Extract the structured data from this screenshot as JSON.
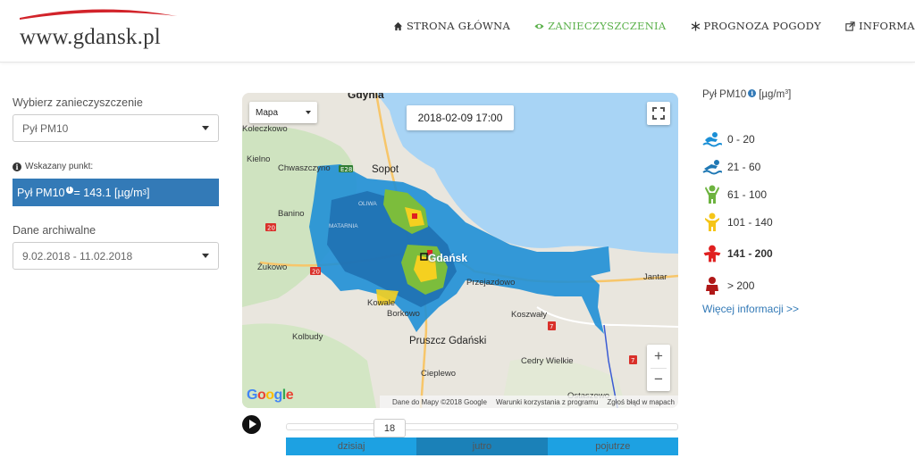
{
  "header": {
    "logo_text": "www.gdansk.pl",
    "nav": [
      {
        "label": "STRONA GŁÓWNA",
        "icon": "home-icon",
        "active": false
      },
      {
        "label": "ZANIECZYSZCZENIA",
        "icon": "eye-icon",
        "active": true
      },
      {
        "label": "PROGNOZA POGODY",
        "icon": "snowflake-icon",
        "active": false
      },
      {
        "label": "INFORMACJE",
        "icon": "external-link-icon",
        "active": false,
        "dropdown": true
      }
    ]
  },
  "sidebar": {
    "pollutant_label": "Wybierz zanieczyszczenie",
    "pollutant_value": "Pył PM10",
    "point_label": "Wskazany punkt:",
    "point_value_prefix": "Pył PM10",
    "point_value_text": " = 143.1 [µg/m",
    "point_value_unit_sup": "3",
    "point_value_suffix": "]",
    "archive_label": "Dane archiwalne",
    "archive_value": "9.02.2018 - 11.02.2018"
  },
  "map": {
    "type_control": "Mapa",
    "datetime": "2018-02-09 17:00",
    "zoom_in": "+",
    "zoom_out": "−",
    "google_logo": "Google",
    "attribution": [
      "Dane do Mapy ©2018 Google",
      "Warunki korzystania z programu",
      "Zgłoś błąd w mapach"
    ],
    "places": [
      "Gdynia",
      "Sopot",
      "Gdańsk",
      "Pruszcz Gdański",
      "Kowale",
      "Borkowo",
      "Chwaszczyno",
      "Banino",
      "Żukowo",
      "Kielno",
      "Koleczkowo",
      "Jantar",
      "Koszwały",
      "Przejazdowo",
      "Cedry Wielkie",
      "Cieplewo",
      "Kolbudy",
      "Ostaszewo",
      "OLIWA",
      "MATARNIA"
    ],
    "roads": [
      "E28",
      "20",
      "20",
      "7",
      "7"
    ]
  },
  "timeline": {
    "hour": "18",
    "days": [
      {
        "label": "dzisiaj",
        "active": false
      },
      {
        "label": "jutro",
        "active": true
      },
      {
        "label": "pojutrze",
        "active": false
      }
    ]
  },
  "legend": {
    "title": "Pył PM10",
    "unit_text": " [µg/m",
    "unit_sup": "3",
    "unit_suffix": "]",
    "items": [
      {
        "range": "0 - 20",
        "color": "#1b8fd6",
        "icon": "swimmer-icon"
      },
      {
        "range": "21 - 60",
        "color": "#1f78b4",
        "icon": "swimmer-icon"
      },
      {
        "range": "61 - 100",
        "color": "#6db33f",
        "icon": "person-arms-up-icon"
      },
      {
        "range": "101 - 140",
        "color": "#f5c518",
        "icon": "person-arms-up-icon"
      },
      {
        "range": "141 - 200",
        "color": "#e02020",
        "icon": "person-sad-icon",
        "bold": true
      },
      {
        "range": "> 200",
        "color": "#b01818",
        "icon": "person-sitting-icon"
      }
    ],
    "more_link": "Więcej informacji >>"
  },
  "colors": {
    "accent": "#5ab04a",
    "primary": "#337ab7",
    "timeline": "#1da1e2",
    "timeline_active": "#1b81b8"
  }
}
